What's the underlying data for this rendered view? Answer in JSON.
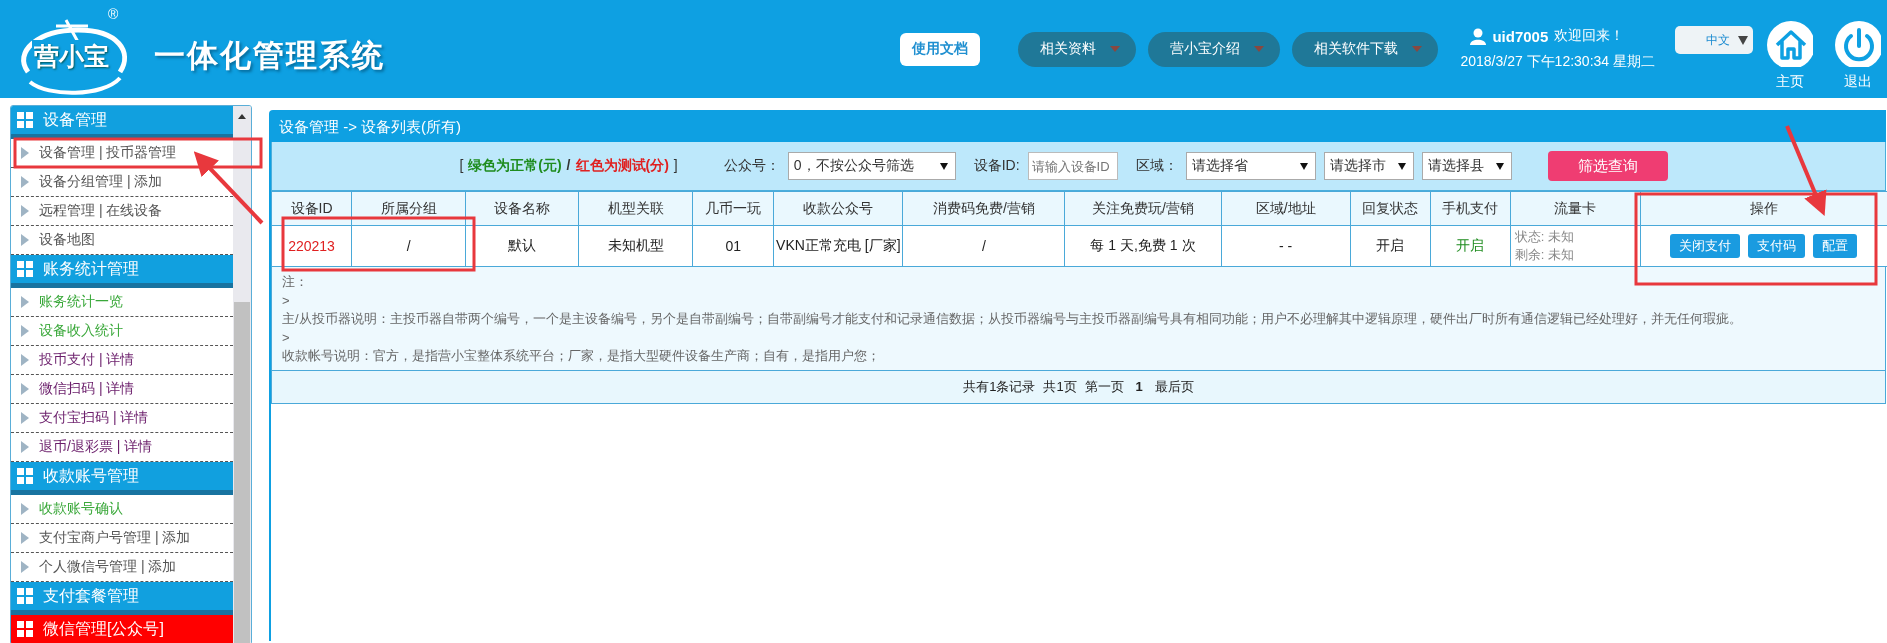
{
  "header": {
    "logo": {
      "text": "营小宝",
      "mark": "®"
    },
    "title": "一体化管理系统",
    "doc_button": "使用文档",
    "menus": [
      "相关资料",
      "营小宝介绍",
      "相关软件下载"
    ],
    "user": {
      "name": "uid7005",
      "greeting": "欢迎回来！",
      "datetime": "2018/3/27 下午12:30:34 星期二"
    },
    "language": "中文",
    "home": "主页",
    "logout": "退出"
  },
  "sidebar": {
    "sections": [
      {
        "title": "设备管理",
        "color": "#11a0df",
        "items": [
          {
            "label": "设备管理 | 投币器管理",
            "color": "#555555"
          },
          {
            "label": "设备分组管理 | 添加",
            "color": "#555555"
          },
          {
            "label": "远程管理 | 在线设备",
            "color": "#555555"
          },
          {
            "label": "设备地图",
            "color": "#555555"
          }
        ]
      },
      {
        "title": "账务统计管理",
        "color": "#11a0df",
        "items": [
          {
            "label": "账务统计一览",
            "color": "#3aa83a"
          },
          {
            "label": "设备收入统计",
            "color": "#3aa83a"
          },
          {
            "label": "投币支付 | 详情",
            "color": "#6b1e6b"
          },
          {
            "label": "微信扫码 | 详情",
            "color": "#6b1e6b"
          },
          {
            "label": "支付宝扫码 | 详情",
            "color": "#6b1e6b"
          },
          {
            "label": "退币/退彩票 | 详情",
            "color": "#6b1e6b"
          }
        ]
      },
      {
        "title": "收款账号管理",
        "color": "#11a0df",
        "items": [
          {
            "label": "收款账号确认",
            "color": "#3aa83a"
          },
          {
            "label": "支付宝商户号管理 | 添加",
            "color": "#555555"
          },
          {
            "label": "个人微信号管理 | 添加",
            "color": "#555555"
          }
        ]
      },
      {
        "title": "支付套餐管理",
        "color": "#11a0df"
      },
      {
        "title": "微信管理[公众号]",
        "color": "#ff0000"
      }
    ]
  },
  "main": {
    "breadcrumb": "设备管理 -> 设备列表(所有)",
    "filter": {
      "legend": [
        {
          "text": "[",
          "color": "#333333"
        },
        {
          "text": "绿色为正常(元)",
          "color": "#1e8c1e"
        },
        {
          "text": "/",
          "color": "#333333"
        },
        {
          "text": "红色为测试(分)",
          "color": "#e02020"
        },
        {
          "text": "]",
          "color": "#333333"
        }
      ],
      "account_label": "公众号：",
      "account_value": "0，不按公众号筛选",
      "id_label": "设备ID:",
      "id_placeholder": "请输入设备ID",
      "region_label": "区域：",
      "province": "请选择省",
      "city": "请选择市",
      "county": "请选择县",
      "search_button": "筛选查询"
    },
    "table": {
      "columns": [
        "设备ID",
        "所属分组",
        "设备名称",
        "机型关联",
        "几币一玩",
        "收款公众号",
        "消费码免费/营销",
        "关注免费玩/营销",
        "区域/地址",
        "回复状态",
        "手机支付",
        "流量卡",
        "操作"
      ],
      "rows": [
        {
          "cells": [
            {
              "kind": "text",
              "text": "220213",
              "color": "#e02020"
            },
            {
              "kind": "text",
              "text": "/"
            },
            {
              "kind": "text",
              "text": "默认"
            },
            {
              "kind": "text",
              "text": "未知机型"
            },
            {
              "kind": "text",
              "text": "01"
            },
            {
              "kind": "text",
              "text": "VKN正常充电 [厂家]"
            },
            {
              "kind": "text",
              "text": "/"
            },
            {
              "kind": "text",
              "text": "每 1 天,免费 1 次"
            },
            {
              "kind": "text",
              "text": "- -"
            },
            {
              "kind": "text",
              "text": "开启"
            },
            {
              "kind": "text",
              "text": "开启",
              "color": "#1e8c1e"
            },
            {
              "kind": "lines",
              "lines": [
                "状态: 未知",
                "剩余: 未知"
              ]
            },
            {
              "kind": "buttons",
              "buttons": [
                "关闭支付",
                "支付码",
                "配置"
              ]
            }
          ]
        }
      ]
    },
    "notes": [
      "注：",
      ">",
      "主/从投币器说明：主投币器自带两个编号，一个是主设备编号，另个是自带副编号；自带副编号才能支付和记录通信数据；从投币器编号与主投币器副编号具有相同功能；用户不必理解其中逻辑原理，硬件出厂时所有通信逻辑已经处理好，并无任何瑕疵。",
      ">",
      "收款帐号说明：官方，是指营小宝整体系统平台；厂家，是指大型硬件设备生产商；自有，是指用户您；"
    ],
    "pagination": [
      {
        "text": "共有1条记录",
        "selected": false
      },
      {
        "text": "共1页",
        "selected": false
      },
      {
        "text": "第一页",
        "selected": false
      },
      {
        "text": "1",
        "selected": true
      },
      {
        "text": "最后页",
        "selected": false
      }
    ]
  }
}
